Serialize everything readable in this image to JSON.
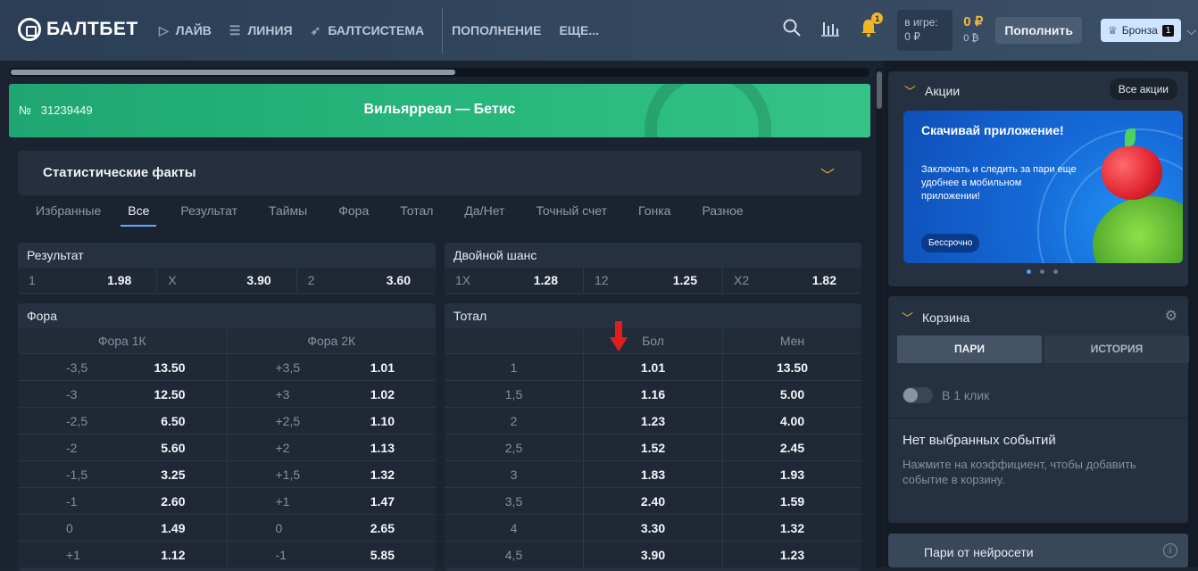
{
  "header": {
    "logo": "БАЛТБЕТ",
    "nav": [
      {
        "label": "ЛАЙВ",
        "icon": "play-icon"
      },
      {
        "label": "ЛИНИЯ",
        "icon": "list-icon"
      },
      {
        "label": "БАЛТСИСТЕМА",
        "icon": "rocket-icon"
      },
      {
        "label": "ПОПОЛНЕНИЕ",
        "icon": ""
      },
      {
        "label": "ЕЩЕ...",
        "icon": ""
      }
    ],
    "notifications_count": "1",
    "in_game_label": "в игре:",
    "in_game_value": "0 ₽",
    "balance_main": "0 ₽",
    "balance_bonus": "0 ₿",
    "topup_label": "Пополнить",
    "status_label": "Бронза",
    "status_level": "1"
  },
  "match": {
    "number_prefix": "№",
    "number": "31239449",
    "title": "Вильярреал — Бетис"
  },
  "stat_facts": {
    "title": "Статистические факты"
  },
  "tabs": [
    "Избранные",
    "Все",
    "Результат",
    "Таймы",
    "Фора",
    "Тотал",
    "Да/Нет",
    "Точный счет",
    "Гонка",
    "Разное"
  ],
  "active_tab": "Все",
  "result": {
    "title": "Результат",
    "odds": [
      {
        "label": "1",
        "value": "1.98"
      },
      {
        "label": "X",
        "value": "3.90"
      },
      {
        "label": "2",
        "value": "3.60"
      }
    ]
  },
  "double_chance": {
    "title": "Двойной шанс",
    "odds": [
      {
        "label": "1X",
        "value": "1.28"
      },
      {
        "label": "12",
        "value": "1.25"
      },
      {
        "label": "X2",
        "value": "1.82"
      }
    ]
  },
  "handicap": {
    "title": "Фора",
    "columns": [
      "Фора 1К",
      "Фора 2К"
    ],
    "rows": [
      [
        {
          "label": "-3,5",
          "value": "13.50"
        },
        {
          "label": "+3,5",
          "value": "1.01"
        }
      ],
      [
        {
          "label": "-3",
          "value": "12.50"
        },
        {
          "label": "+3",
          "value": "1.02"
        }
      ],
      [
        {
          "label": "-2,5",
          "value": "6.50"
        },
        {
          "label": "+2,5",
          "value": "1.10"
        }
      ],
      [
        {
          "label": "-2",
          "value": "5.60"
        },
        {
          "label": "+2",
          "value": "1.13"
        }
      ],
      [
        {
          "label": "-1,5",
          "value": "3.25"
        },
        {
          "label": "+1,5",
          "value": "1.32"
        }
      ],
      [
        {
          "label": "-1",
          "value": "2.60"
        },
        {
          "label": "+1",
          "value": "1.47"
        }
      ],
      [
        {
          "label": "0",
          "value": "1.49"
        },
        {
          "label": "0",
          "value": "2.65"
        }
      ],
      [
        {
          "label": "+1",
          "value": "1.12"
        },
        {
          "label": "-1",
          "value": "5.85"
        }
      ]
    ]
  },
  "total": {
    "title": "Тотал",
    "columns": [
      "",
      "Бол",
      "Мен"
    ],
    "rows": [
      [
        "1",
        "1.01",
        "13.50"
      ],
      [
        "1,5",
        "1.16",
        "5.00"
      ],
      [
        "2",
        "1.23",
        "4.00"
      ],
      [
        "2,5",
        "1.52",
        "2.45"
      ],
      [
        "3",
        "1.83",
        "1.93"
      ],
      [
        "3,5",
        "2.40",
        "1.59"
      ],
      [
        "4",
        "3.30",
        "1.32"
      ],
      [
        "4,5",
        "3.90",
        "1.23"
      ]
    ]
  },
  "sidebar": {
    "promos_title": "Акции",
    "all_promos": "Все акции",
    "banner_title": "Скачивай приложение!",
    "banner_text": "Заключать и следить за пари еще удобнее в мобильном приложении!",
    "banner_badge": "Бессрочно",
    "cart_title": "Корзина",
    "cart_tabs": [
      "ПАРИ",
      "ИСТОРИЯ"
    ],
    "one_click_label": "В 1 клик",
    "empty_title": "Нет выбранных событий",
    "empty_text": "Нажмите на коэффициент, чтобы добавить событие в корзину.",
    "ai_label": "Пари от нейросети"
  },
  "colors": {
    "accent": "#f1b52a",
    "match_banner": "#27b77c",
    "highlight_arrow": "#e01e1e",
    "tab_underline": "#5fa8ff"
  }
}
